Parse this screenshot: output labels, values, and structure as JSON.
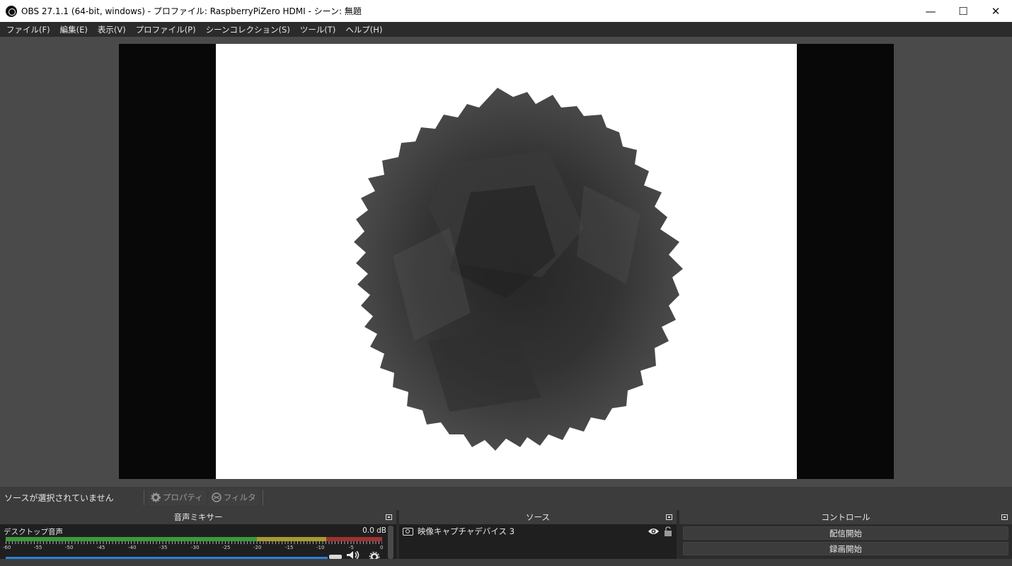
{
  "window": {
    "title": "OBS 27.1.1 (64-bit, windows) - プロファイル: RaspberryPiZero HDMI - シーン: 無題",
    "minimize": "—",
    "maximize": "☐",
    "close": "✕"
  },
  "menu": [
    "ファイル(F)",
    "編集(E)",
    "表示(V)",
    "プロファイル(P)",
    "シーンコレクション(S)",
    "ツール(T)",
    "ヘルプ(H)"
  ],
  "source_toolbar": {
    "no_selection": "ソースが選択されていません",
    "properties": "プロパティ",
    "filters": "フィルタ"
  },
  "mixer": {
    "title": "音声ミキサー",
    "channel": "デスクトップ音声",
    "level": "0.0 dB",
    "ticks": [
      "-60",
      "-55",
      "-50",
      "-45",
      "-40",
      "-35",
      "-30",
      "-25",
      "-20",
      "-15",
      "-10",
      "-5",
      "0"
    ]
  },
  "sources": {
    "title": "ソース",
    "items": [
      {
        "name": "映像キャプチャデバイス 3",
        "visible": true,
        "locked": false
      }
    ]
  },
  "controls": {
    "title": "コントロール",
    "start_streaming": "配信開始",
    "start_recording": "録画開始"
  }
}
